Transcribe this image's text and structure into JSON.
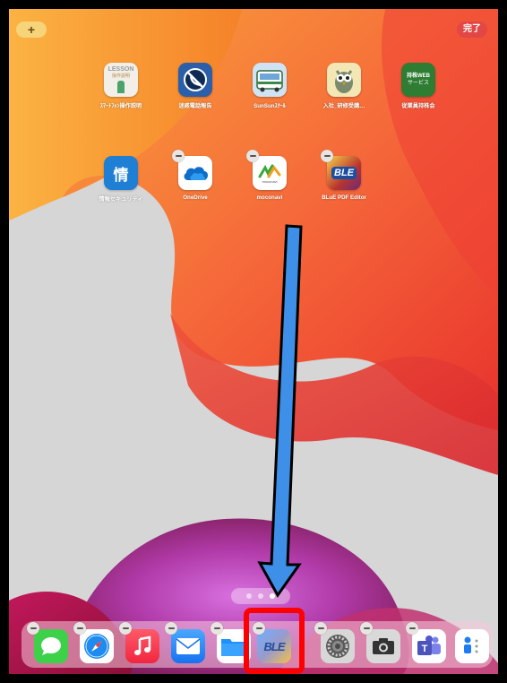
{
  "top_bar": {
    "add_label": "+",
    "done_label": "完了"
  },
  "apps_row1": [
    {
      "name": "lesson",
      "label": "ｽﾏｰﾄﾌｫﾝ操作説明",
      "icon_text_top": "LESSON",
      "icon_text_sub": "操作説明",
      "icon": "lesson-icon"
    },
    {
      "name": "spam-call",
      "label": "迷惑電話報告",
      "icon": "no-phone-icon"
    },
    {
      "name": "sunsun",
      "label": "SunSunｽｸｰﾙ",
      "icon": "bus-icon"
    },
    {
      "name": "training",
      "label": "入社_研修受講…",
      "icon": "owl-icon"
    },
    {
      "name": "employee-web",
      "label": "従業員持株会",
      "icon_text_top": "持株WEB",
      "icon_text_sub": "サービス",
      "icon": "web-service-icon"
    }
  ],
  "apps_row2": [
    {
      "name": "infosec",
      "label": "情報セキュリティ",
      "icon_text_top": "情",
      "icon": "info-security-icon"
    },
    {
      "name": "onedrive",
      "label": "OneDrive",
      "icon": "cloud-icon"
    },
    {
      "name": "moconavi",
      "label": "moconavi",
      "icon_text_sub": "moconavi",
      "icon": "moconavi-icon"
    },
    {
      "name": "blue-pdf",
      "label": "BLuE PDF Editor",
      "icon_text_top": "BLE",
      "icon": "blue-pdf-icon"
    }
  ],
  "dock": [
    {
      "name": "messages",
      "icon": "message-bubble-icon"
    },
    {
      "name": "safari",
      "icon": "compass-icon"
    },
    {
      "name": "music",
      "icon": "music-note-icon"
    },
    {
      "name": "mail",
      "icon": "envelope-icon"
    },
    {
      "name": "files",
      "icon": "folder-icon"
    },
    {
      "name": "blue-pdf-dock",
      "icon": "blue-pdf-icon",
      "icon_text_top": "BLE"
    },
    {
      "name": "settings",
      "icon": "gear-icon"
    },
    {
      "name": "camera",
      "icon": "camera-icon"
    },
    {
      "name": "teams",
      "icon": "teams-icon"
    },
    {
      "name": "contacts-util",
      "icon": "app-list-icon"
    }
  ],
  "page_indicator": {
    "pages": 3,
    "current": 3
  },
  "colors": {
    "arrow_fill": "#3d8fe8",
    "highlight": "#ff0000",
    "done_button": "#e24745",
    "add_button": "#f7d37a"
  }
}
